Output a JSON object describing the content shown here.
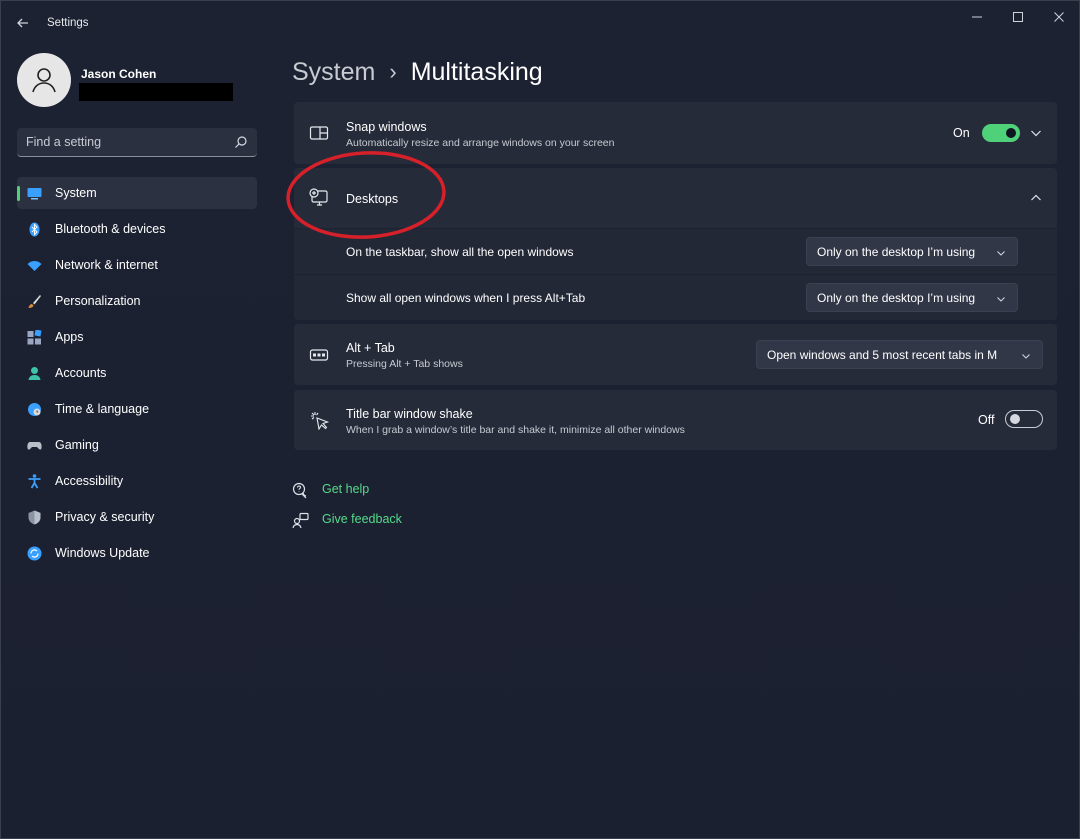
{
  "window": {
    "title": "Settings"
  },
  "profile": {
    "name": "Jason Cohen"
  },
  "search": {
    "placeholder": "Find a setting"
  },
  "sidebar": {
    "items": [
      {
        "label": "System",
        "icon": "monitor-icon",
        "color": "#3aa0ff"
      },
      {
        "label": "Bluetooth & devices",
        "icon": "bluetooth-icon",
        "color": "#3aa0ff"
      },
      {
        "label": "Network & internet",
        "icon": "wifi-icon",
        "color": "#3aa0ff"
      },
      {
        "label": "Personalization",
        "icon": "brush-icon",
        "color": "#e08a3c"
      },
      {
        "label": "Apps",
        "icon": "apps-icon",
        "color": "#9aa6c2"
      },
      {
        "label": "Accounts",
        "icon": "person-icon",
        "color": "#3ec3a6"
      },
      {
        "label": "Time & language",
        "icon": "globe-clock-icon",
        "color": "#3aa0ff"
      },
      {
        "label": "Gaming",
        "icon": "gamepad-icon",
        "color": "#b9bec8"
      },
      {
        "label": "Accessibility",
        "icon": "accessibility-icon",
        "color": "#3aa0ff"
      },
      {
        "label": "Privacy & security",
        "icon": "shield-icon",
        "color": "#8c94a3"
      },
      {
        "label": "Windows Update",
        "icon": "update-icon",
        "color": "#3aa0ff"
      }
    ]
  },
  "header": {
    "parent": "System",
    "separator": "›",
    "current": "Multitasking"
  },
  "settings": {
    "snap": {
      "title": "Snap windows",
      "subtitle": "Automatically resize and arrange windows on your screen",
      "state_label": "On",
      "enabled": true
    },
    "desktops": {
      "title": "Desktops",
      "rows": [
        {
          "label": "On the taskbar, show all the open windows",
          "value": "Only on the desktop I’m using"
        },
        {
          "label": "Show all open windows when I press Alt+Tab",
          "value": "Only on the desktop I’m using"
        }
      ]
    },
    "alttab": {
      "title": "Alt + Tab",
      "subtitle": "Pressing Alt + Tab shows",
      "value": "Open windows and 5 most recent tabs in M"
    },
    "shake": {
      "title": "Title bar window shake",
      "subtitle": "When I grab a window’s title bar and shake it, minimize all other windows",
      "state_label": "Off",
      "enabled": false
    }
  },
  "links": {
    "help": "Get help",
    "feedback": "Give feedback"
  },
  "colors": {
    "accent": "#4fd17a",
    "link": "#55d98a",
    "annotation": "#d6202a"
  }
}
